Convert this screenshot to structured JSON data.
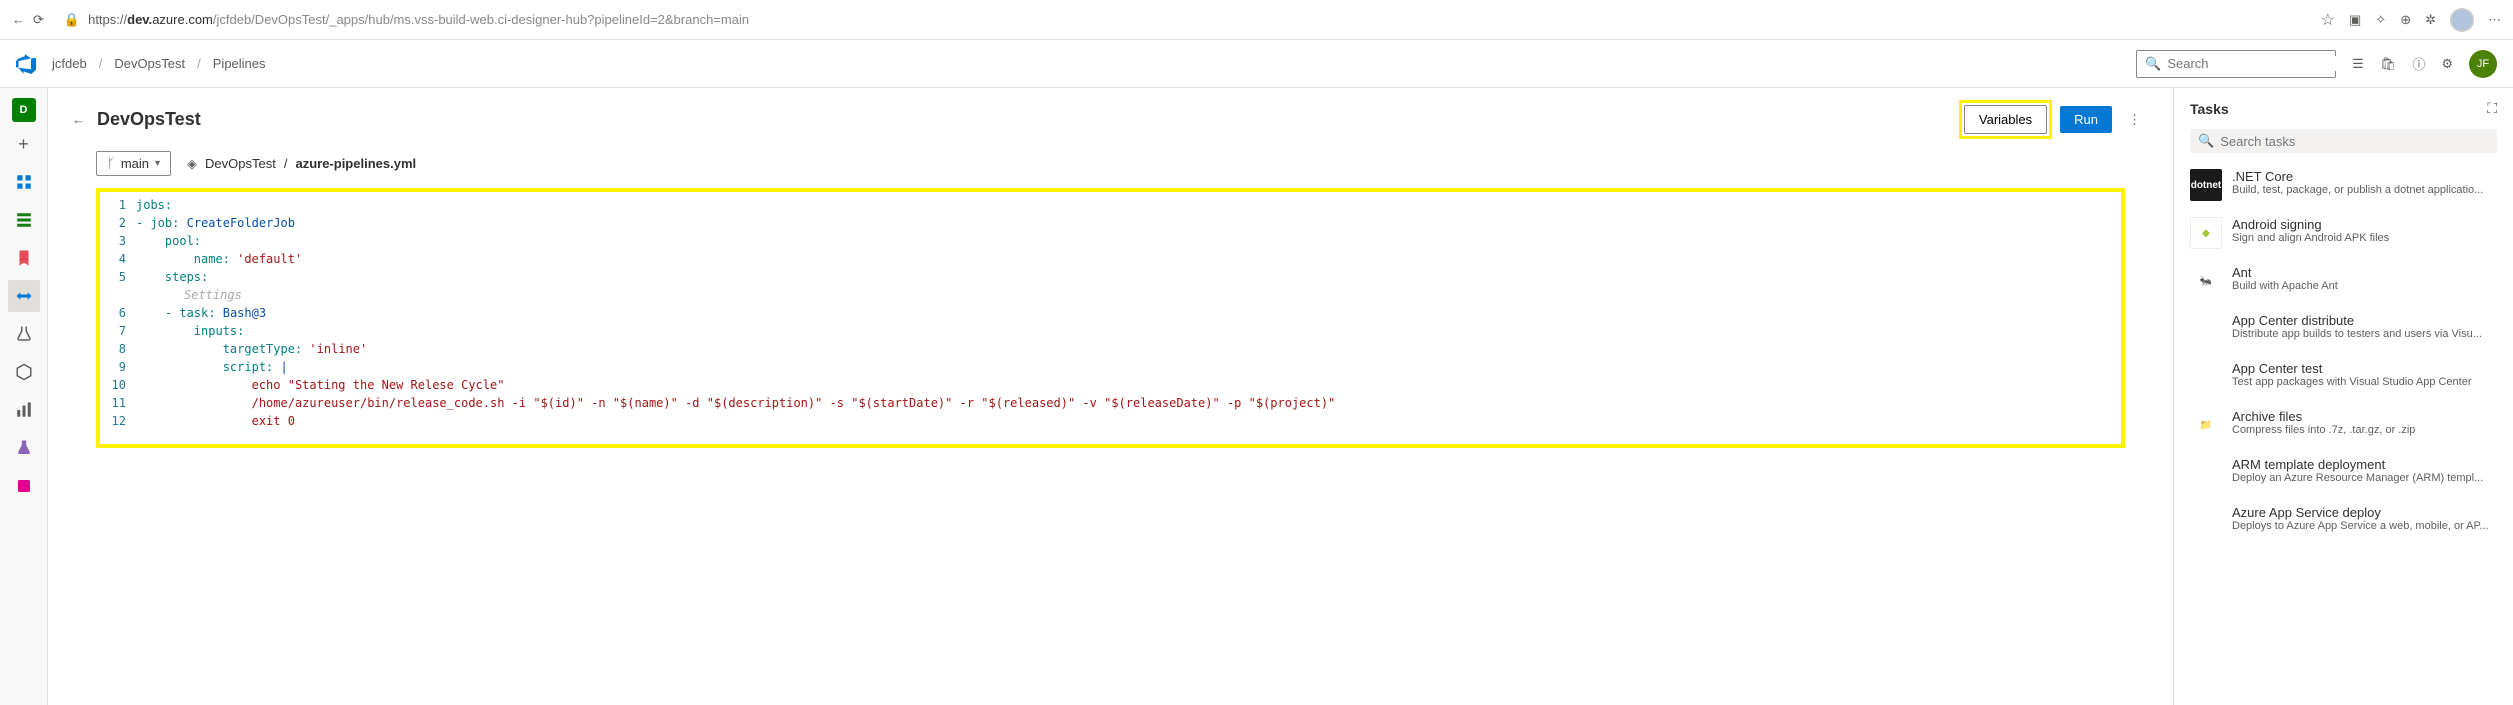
{
  "browser": {
    "url_domain": "dev.",
    "url_host": "azure.com",
    "url_path": "/jcfdeb/DevOpsTest/_apps/hub/ms.vss-build-web.ci-designer-hub?pipelineId=2&branch=main"
  },
  "breadcrumb": {
    "org": "jcfdeb",
    "project": "DevOpsTest",
    "section": "Pipelines"
  },
  "header": {
    "search_placeholder": "Search",
    "avatar_initials": "JF",
    "project_initial": "D"
  },
  "page": {
    "title": "DevOpsTest",
    "variables_btn": "Variables",
    "run_btn": "Run"
  },
  "subheader": {
    "branch": "main",
    "repo": "DevOpsTest",
    "filename": "azure-pipelines.yml"
  },
  "code": {
    "lines": [
      {
        "n": 1,
        "t": "key",
        "indent": 0,
        "text": "jobs:"
      },
      {
        "n": 2,
        "t": "kv",
        "indent": 0,
        "prefix": "- ",
        "key": "job",
        "val": "CreateFolderJob",
        "valtype": "plain"
      },
      {
        "n": 3,
        "t": "key",
        "indent": 2,
        "text": "pool:"
      },
      {
        "n": 4,
        "t": "kv",
        "indent": 4,
        "key": "name",
        "val": "'default'",
        "valtype": "str"
      },
      {
        "n": 5,
        "t": "key",
        "indent": 2,
        "text": "steps:"
      },
      {
        "n": "",
        "t": "hint",
        "text": "Settings"
      },
      {
        "n": 6,
        "t": "kv",
        "indent": 2,
        "prefix": "- ",
        "key": "task",
        "val": "Bash@3",
        "valtype": "plain"
      },
      {
        "n": 7,
        "t": "key",
        "indent": 4,
        "text": "inputs:"
      },
      {
        "n": 8,
        "t": "kv",
        "indent": 6,
        "key": "targetType",
        "val": "'inline'",
        "valtype": "str"
      },
      {
        "n": 9,
        "t": "kv",
        "indent": 6,
        "key": "script",
        "val": "|",
        "valtype": "plain"
      },
      {
        "n": 10,
        "t": "str",
        "indent": 8,
        "text": "echo \"Stating the New Relese Cycle\""
      },
      {
        "n": 11,
        "t": "str",
        "indent": 8,
        "text": "/home/azureuser/bin/release_code.sh -i \"$(id)\" -n \"$(name)\" -d \"$(description)\" -s \"$(startDate)\" -r \"$(released)\" -v \"$(releaseDate)\" -p \"$(project)\""
      },
      {
        "n": 12,
        "t": "str",
        "indent": 8,
        "text": "exit 0"
      }
    ]
  },
  "tasks": {
    "title": "Tasks",
    "search_placeholder": "Search tasks",
    "items": [
      {
        "name": ".NET Core",
        "desc": "Build, test, package, or publish a dotnet applicatio...",
        "icon": "dotnet",
        "iconTxt": "dotnet"
      },
      {
        "name": "Android signing",
        "desc": "Sign and align Android APK files",
        "icon": "android",
        "iconTxt": "◆"
      },
      {
        "name": "Ant",
        "desc": "Build with Apache Ant",
        "icon": "ant",
        "iconTxt": "🐜"
      },
      {
        "name": "App Center distribute",
        "desc": "Distribute app builds to testers and users via Visu...",
        "icon": "appcenter",
        "iconTxt": "◈"
      },
      {
        "name": "App Center test",
        "desc": "Test app packages with Visual Studio App Center",
        "icon": "appcenter",
        "iconTxt": "◈"
      },
      {
        "name": "Archive files",
        "desc": "Compress files into .7z, .tar.gz, or .zip",
        "icon": "archive",
        "iconTxt": "📁"
      },
      {
        "name": "ARM template deployment",
        "desc": "Deploy an Azure Resource Manager (ARM) templ...",
        "icon": "arm",
        "iconTxt": "▦"
      },
      {
        "name": "Azure App Service deploy",
        "desc": "Deploys to Azure App Service a web, mobile, or AP...",
        "icon": "azure",
        "iconTxt": "◆"
      }
    ]
  }
}
